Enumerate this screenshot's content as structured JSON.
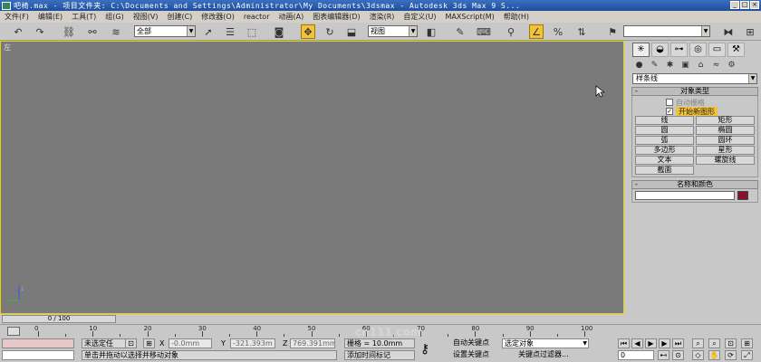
{
  "titlebar": {
    "text": "吧椅.max    - 项目文件夹: C:\\Documents and Settings\\Administrator\\My Documents\\3dsmax    - Autodesk 3ds Max 9 S..."
  },
  "menu": [
    "文件(F)",
    "编辑(E)",
    "工具(T)",
    "组(G)",
    "视图(V)",
    "创建(C)",
    "修改器(O)",
    "reactor",
    "动画(A)",
    "图表编辑器(D)",
    "渲染(R)",
    "自定义(U)",
    "MAXScript(M)",
    "帮助(H)"
  ],
  "toolbar": {
    "selection_filter": "全部",
    "ref_coord": "视图",
    "named_selection": ""
  },
  "viewport": {
    "label": "左",
    "axis_z": "z",
    "axis_y": "y"
  },
  "cmdpanel": {
    "category": "样条线",
    "object_type_title": "对象类型",
    "autogrid": "自动栅格",
    "start_new_shape": "开始新图形",
    "shapes": [
      "线",
      "矩形",
      "圆",
      "椭圆",
      "弧",
      "圆环",
      "多边形",
      "星形",
      "文本",
      "螺旋线",
      "截面"
    ],
    "name_color_title": "名称和颜色",
    "color_hex": "#8b0f2f"
  },
  "timeline": {
    "slider": "0 / 100",
    "ticks": [
      "0",
      "10",
      "20",
      "30",
      "40",
      "50",
      "60",
      "70",
      "80",
      "90",
      "100"
    ]
  },
  "status": {
    "selection": "未选定任",
    "x_label": "X",
    "x_value": "-0.0mm",
    "y_label": "Y",
    "y_value": "-321.393m",
    "z_label": "Z",
    "z_value": "769.391mm",
    "grid": "栅格 = 10.0mm",
    "prompt": "单击并拖动以选择并移动对象",
    "add_time_tag": "添加时间标记",
    "auto_key": "自动关键点",
    "set_key": "设置关键点",
    "selected_objects": "选定对象",
    "key_filters": "关键点过滤器...",
    "frame": "0",
    "watermark": "cn111.com"
  }
}
